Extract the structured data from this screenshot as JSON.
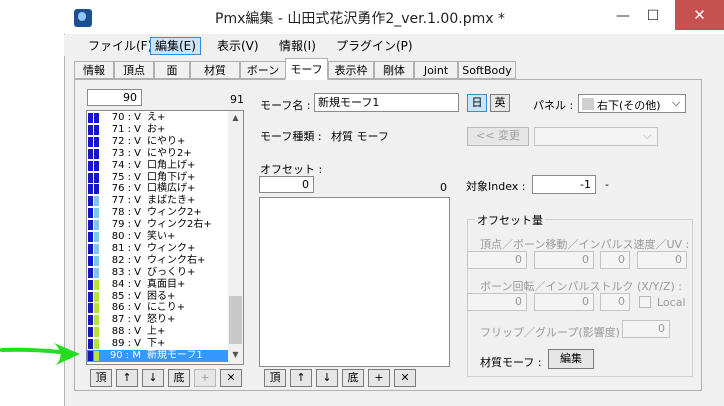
{
  "window": {
    "title": "Pmx編集 - 山田式花沢勇作2_ver.1.00.pmx *",
    "minimize": "—",
    "maximize": "☐",
    "close": "✕"
  },
  "menu": [
    {
      "label": "ファイル(F)"
    },
    {
      "label": "編集(E)"
    },
    {
      "label": "表示(V)"
    },
    {
      "label": "情報(I)"
    },
    {
      "label": "プラグイン(P)"
    }
  ],
  "tabs": [
    "情報",
    "頂点",
    "面",
    "材質",
    "ボーン",
    "モーフ",
    "表示枠",
    "剛体",
    "Joint",
    "SoftBody"
  ],
  "morph_list": {
    "index_value": "90",
    "count": "91",
    "items": [
      {
        "no": "70 : V",
        "name": "え+",
        "color": "#1414c8"
      },
      {
        "no": "71 : V",
        "name": "お+",
        "color": "#1414c8"
      },
      {
        "no": "72 : V",
        "name": "にやり+",
        "color": "#1414c8"
      },
      {
        "no": "73 : V",
        "name": "にやり2+",
        "color": "#1414c8"
      },
      {
        "no": "74 : V",
        "name": "口角上げ+",
        "color": "#1414c8"
      },
      {
        "no": "75 : V",
        "name": "口角下げ+",
        "color": "#1414c8"
      },
      {
        "no": "76 : V",
        "name": "口横広げ+",
        "color": "#1414c8"
      },
      {
        "no": "77 : V",
        "name": "まばたき+",
        "color": "#7ec8f0"
      },
      {
        "no": "78 : V",
        "name": "ウィンク2+",
        "color": "#7ec8f0"
      },
      {
        "no": "79 : V",
        "name": "ウィンク2右+",
        "color": "#7ec8f0"
      },
      {
        "no": "80 : V",
        "name": "笑い+",
        "color": "#7ec8f0"
      },
      {
        "no": "81 : V",
        "name": "ウィンク+",
        "color": "#7ec8f0"
      },
      {
        "no": "82 : V",
        "name": "ウィンク右+",
        "color": "#7ec8f0"
      },
      {
        "no": "83 : V",
        "name": "びっくり+",
        "color": "#7ec8f0"
      },
      {
        "no": "84 : V",
        "name": "真面目+",
        "color": "#b6e23c"
      },
      {
        "no": "85 : V",
        "name": "困る+",
        "color": "#b6e23c"
      },
      {
        "no": "86 : V",
        "name": "にこり+",
        "color": "#b6e23c"
      },
      {
        "no": "87 : V",
        "name": "怒り+",
        "color": "#b6e23c"
      },
      {
        "no": "88 : V",
        "name": "上+",
        "color": "#b6e23c"
      },
      {
        "no": "89 : V",
        "name": "下+",
        "color": "#b6e23c"
      },
      {
        "no": "90 : M",
        "name": "新規モーフ1",
        "color": "#b6e23c"
      }
    ],
    "buttons": [
      "頂",
      "↑",
      "↓",
      "底",
      "+",
      "✕"
    ]
  },
  "morph": {
    "name_label": "モーフ名 :",
    "name_value": "新規モーフ1",
    "lang_jp": "日",
    "lang_en": "英",
    "panel_label": "パネル :",
    "panel_value": "右下(その他)",
    "type_label": "モーフ種類 :",
    "type_value": "材質 モーフ",
    "change_button": "<< 変更"
  },
  "offset": {
    "label": "オフセット :",
    "value": "0",
    "count": "0",
    "buttons": [
      "頂",
      "↑",
      "↓",
      "底",
      "+",
      "✕"
    ]
  },
  "target": {
    "label": "対象Index :",
    "value": "-1",
    "dash": "-"
  },
  "offset_amount": {
    "title": "オフセット量",
    "row1_label": "頂点／ボーン移動／インパルス速度／UV :",
    "row1_values": [
      "0",
      "0",
      "0",
      "0"
    ],
    "row2_label": "ボーン回転／インパルストルク (X/Y/Z) :",
    "row2_values": [
      "0",
      "0",
      "0"
    ],
    "local_label": "Local",
    "flip_label": "フリップ／グループ(影響度) :",
    "flip_value": "0",
    "material_label": "材質モーフ :",
    "material_button": "編集"
  }
}
